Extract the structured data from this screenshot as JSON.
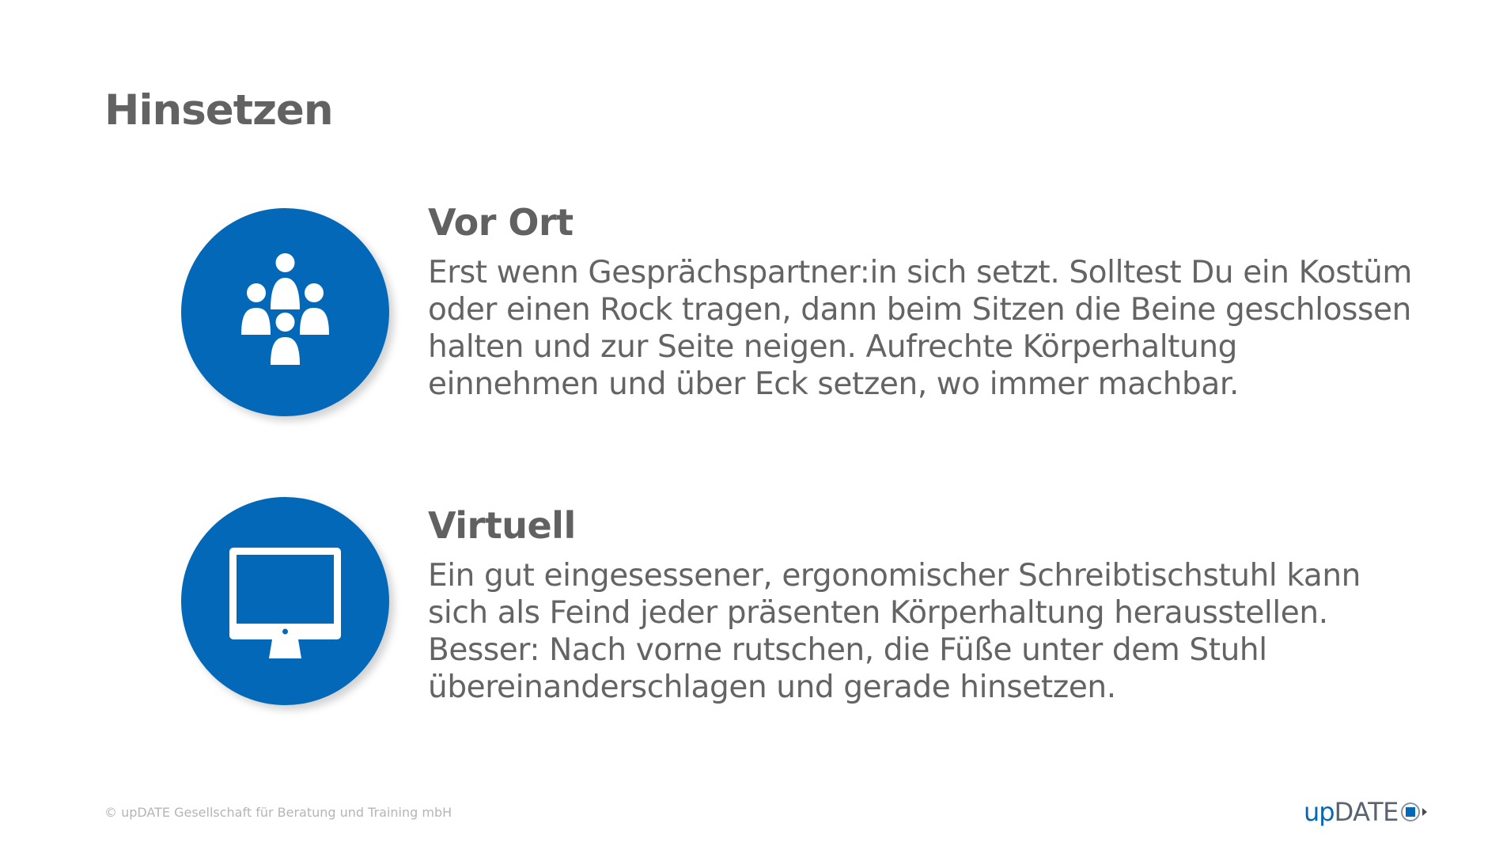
{
  "page": {
    "title": "Hinsetzen"
  },
  "sections": [
    {
      "icon": "group-of-people-icon",
      "heading": "Vor Ort",
      "body": "Erst wenn Gesprächspartner:in sich setzt. Solltest Du ein Kostüm oder einen Rock tragen, dann beim Sitzen die Beine geschlossen halten und zur Seite neigen. Aufrechte Körperhaltung einnehmen und über Eck setzen, wo immer machbar."
    },
    {
      "icon": "desktop-monitor-icon",
      "heading": "Virtuell",
      "body": "Ein gut eingesessener, ergonomischer Schreibtischstuhl kann sich als Feind jeder präsenten Körperhaltung herausstellen. Besser: Nach vorne rutschen, die Füße unter dem Stuhl übereinanderschlagen und gerade hinsetzen."
    }
  ],
  "footer": {
    "copyright": "© upDATE Gesellschaft für Beratung und Training mbH",
    "logo_up": "up",
    "logo_date": "DATE"
  },
  "colors": {
    "accent": "#0468b8",
    "text": "#616161",
    "footer_text": "#b5b5b5"
  }
}
